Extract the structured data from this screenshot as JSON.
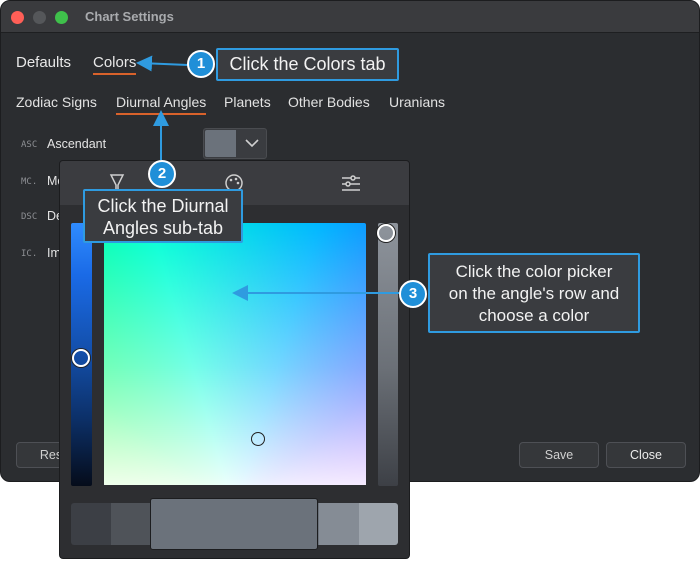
{
  "window": {
    "title": "Chart Settings"
  },
  "tabs": [
    {
      "label": "Defaults",
      "active": false
    },
    {
      "label": "Colors",
      "active": true
    }
  ],
  "subtabs": [
    {
      "label": "Zodiac Signs",
      "active": false
    },
    {
      "label": "Diurnal Angles",
      "active": true
    },
    {
      "label": "Planets",
      "active": false
    },
    {
      "label": "Other Bodies",
      "active": false
    },
    {
      "label": "Uranians",
      "active": false
    }
  ],
  "angles": [
    {
      "abbr": "ASC",
      "label": "Ascendant"
    },
    {
      "abbr": "MC.",
      "label": "Me"
    },
    {
      "abbr": "DSC",
      "label": "De"
    },
    {
      "abbr": "IC.",
      "label": "Im"
    }
  ],
  "color_swatch": "#6b727b",
  "footer": {
    "reset_label": "Res",
    "save_label": "Save",
    "close_label": "Close"
  },
  "picker": {
    "tabs": [
      "eyedropper-icon",
      "palette-icon",
      "sliders-icon"
    ],
    "palette_colors": [
      "#3c3f45",
      "#4f5359",
      "#6b727b",
      "#858c95",
      "#9ea5ad"
    ],
    "selected_color": "#6b727b"
  },
  "callouts": [
    {
      "number": "1",
      "text": "Click the Colors tab"
    },
    {
      "number": "2",
      "text_line1": "Click the Diurnal",
      "text_line2": "Angles sub-tab"
    },
    {
      "number": "3",
      "text_line1": "Click the color picker",
      "text_line2": "on the angle's row and",
      "text_line3": "choose a color"
    }
  ],
  "accent_color": "#d9622b",
  "callout_color": "#2f9be0"
}
